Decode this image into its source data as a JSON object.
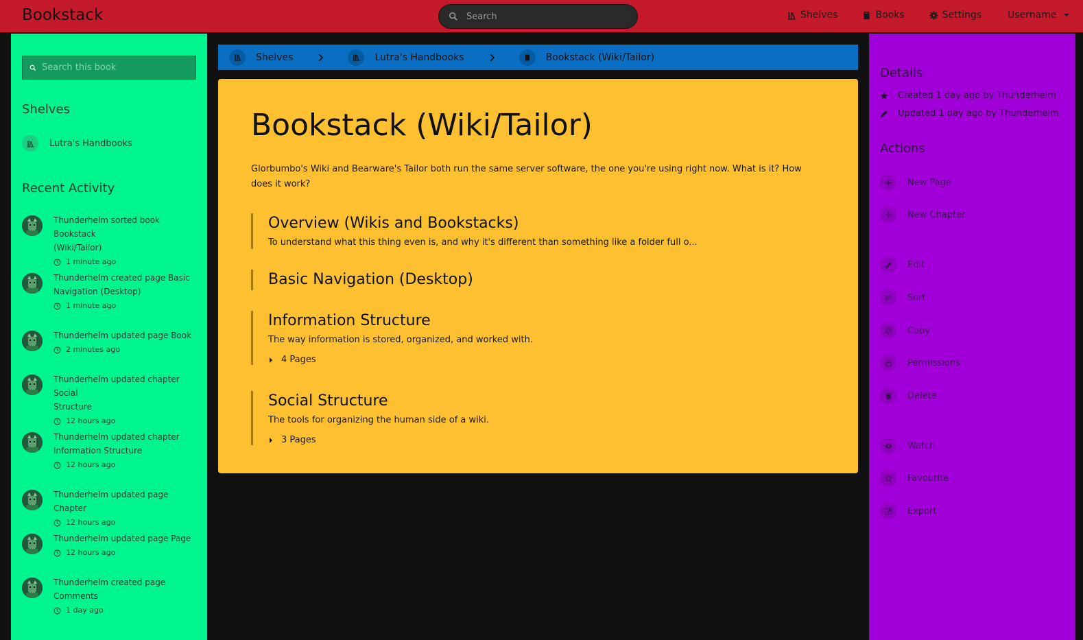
{
  "header": {
    "logo": "Bookstack",
    "search_placeholder": "Search",
    "nav": {
      "shelves": "Shelves",
      "books": "Books",
      "settings": "Settings",
      "username": "Username"
    }
  },
  "left": {
    "search_placeholder": "Search this book",
    "shelves_heading": "Shelves",
    "shelf_item": "Lutra's Handbooks",
    "recent_heading": "Recent Activity",
    "activity": [
      {
        "line1": "Thunderhelm sorted book Bookstack",
        "line2": "(Wiki/Tailor)",
        "time": "1 minute ago"
      },
      {
        "line1": "Thunderhelm created page Basic",
        "line2": "Navigation (Desktop)",
        "time": "1 minute ago"
      },
      {
        "line1": "Thunderhelm updated page Book",
        "line2": "",
        "time": "2 minutes ago"
      },
      {
        "line1": "Thunderhelm updated chapter Social",
        "line2": "Structure",
        "time": "12 hours ago"
      },
      {
        "line1": "Thunderhelm updated chapter",
        "line2": "Information Structure",
        "time": "12 hours ago"
      },
      {
        "line1": "Thunderhelm updated page Chapter",
        "line2": "",
        "time": "12 hours ago"
      },
      {
        "line1": "Thunderhelm updated page Page",
        "line2": "",
        "time": "12 hours ago"
      },
      {
        "line1": "Thunderhelm created page",
        "line2": "Comments",
        "time": "1 day ago"
      }
    ]
  },
  "breadcrumb": {
    "shelves": "Shelves",
    "shelf": "Lutra's Handbooks",
    "book": "Bookstack (Wiki/Tailor)"
  },
  "book": {
    "title": "Bookstack (Wiki/Tailor)",
    "description": "Glorbumbo's Wiki and Bearware's Tailor both run the same server software, the one you're using right now. What is it? How does it work?",
    "entries": [
      {
        "title": "Overview (Wikis and Bookstacks)",
        "excerpt": "To understand what this thing even is, and why it's different than something like a folder full o...",
        "pages": ""
      },
      {
        "title": "Basic Navigation (Desktop)",
        "excerpt": "",
        "pages": ""
      },
      {
        "title": "Information Structure",
        "excerpt": "The way information is stored, organized, and worked with.",
        "pages": "4 Pages"
      },
      {
        "title": "Social Structure",
        "excerpt": "The tools for organizing the human side of a wiki.",
        "pages": "3 Pages"
      }
    ]
  },
  "right": {
    "details_heading": "Details",
    "created": "Created 1 day ago by Thunderhelm",
    "updated": "Updated 1 day ago by Thunderhelm",
    "actions_heading": "Actions",
    "actions": {
      "new_page": "New Page",
      "new_chapter": "New Chapter",
      "edit": "Edit",
      "sort": "Sort",
      "copy": "Copy",
      "permissions": "Permissions",
      "delete": "Delete",
      "watch": "Watch",
      "favourite": "Favourite",
      "export": "Export"
    }
  }
}
